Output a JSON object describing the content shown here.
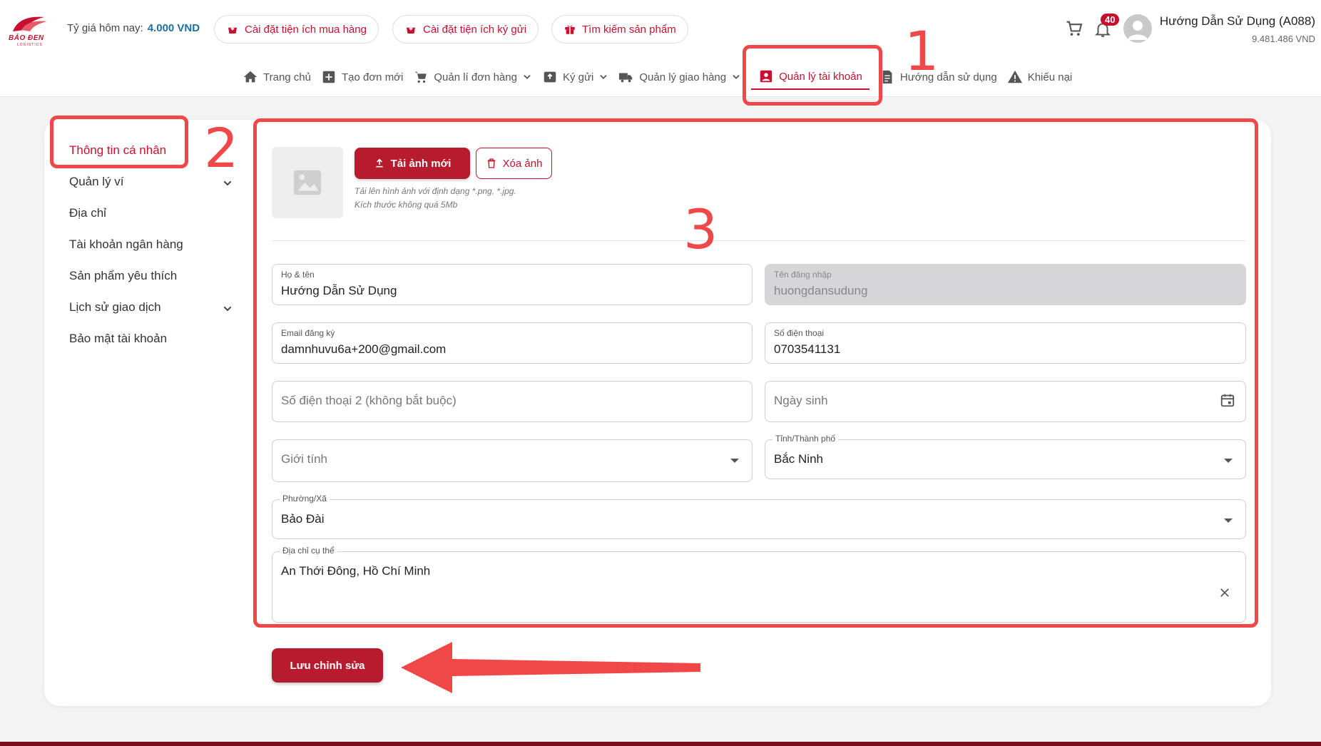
{
  "header": {
    "logo_text": "BẢO ĐEN",
    "logo_sub": "LOGISTICS",
    "rate_label": "Tỷ giá hôm nay:",
    "rate_value": "4.000 VND",
    "pills": [
      "Cài đặt tiện ích mua hàng",
      "Cài đặt tiện ích ký gửi",
      "Tìm kiếm sản phẩm"
    ],
    "notification_count": "40",
    "user_name": "Hướng Dẫn Sử Dụng (A088)",
    "user_balance": "9.481.486 VND"
  },
  "nav": {
    "items": [
      "Trang chủ",
      "Tạo đơn mới",
      "Quản lí đơn hàng",
      "Ký gửi",
      "Quản lý giao hàng",
      "Quản lý tài khoản",
      "Hướng dẫn sử dụng",
      "Khiếu nại"
    ],
    "active": "Quản lý tài khoản"
  },
  "sidebar": {
    "items": [
      "Thông tin cá nhân",
      "Quản lý ví",
      "Địa chỉ",
      "Tài khoản ngân hàng",
      "Sản phẩm yêu thích",
      "Lịch sử giao dịch",
      "Bảo mật tài khoản"
    ]
  },
  "avatar": {
    "upload_label": "Tải ảnh mới",
    "delete_label": "Xóa ảnh",
    "hint_line1": "Tải lên hình ảnh với định dạng *.png, *.jpg.",
    "hint_line2": "Kích thước không quá 5Mb"
  },
  "form": {
    "fullname": {
      "label": "Họ & tên",
      "value": "Hướng Dẫn Sử Dụng"
    },
    "username": {
      "label": "Tên đăng nhập",
      "value": "huongdansudung"
    },
    "email": {
      "label": "Email đăng ký",
      "value": "damnhuvu6a+200@gmail.com"
    },
    "phone": {
      "label": "Số điện thoại",
      "value": "0703541131"
    },
    "phone2": {
      "placeholder": "Số điện thoại 2 (không bắt buộc)"
    },
    "birthday": {
      "placeholder": "Ngày sinh"
    },
    "gender": {
      "placeholder": "Giới tính"
    },
    "province": {
      "label": "Tỉnh/Thành phố",
      "value": "Bắc Ninh"
    },
    "ward": {
      "label": "Phường/Xã",
      "value": "Bảo Đài"
    },
    "address": {
      "label": "Địa chỉ cụ thể",
      "value": "An Thới Đông, Hồ Chí Minh"
    }
  },
  "save_label": "Lưu chỉnh sửa",
  "annotations": [
    "1",
    "2",
    "3"
  ],
  "colors": {
    "brand": "#c8102e",
    "annotation": "#f04848",
    "rate": "#1b6fa8"
  }
}
